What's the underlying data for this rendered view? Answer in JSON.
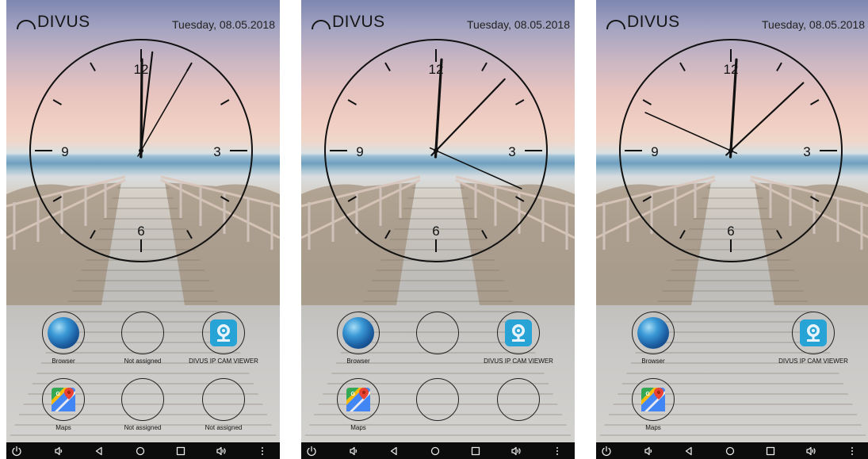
{
  "screens": [
    {
      "logo": "DIVUS",
      "date": "Tuesday, 08.05.2018",
      "clock": {
        "numerals": [
          "12",
          "3",
          "6",
          "9"
        ],
        "time": {
          "hour": 12,
          "minute": 1,
          "second": 5
        }
      },
      "slots": [
        {
          "label": "Browser",
          "icon": "globe-icon"
        },
        {
          "label": "Not assigned",
          "icon": "empty"
        },
        {
          "label": "DIVUS IP CAM VIEWER",
          "icon": "camera-icon"
        },
        {
          "label": "Maps",
          "icon": "maps-icon"
        },
        {
          "label": "Not assigned",
          "icon": "empty"
        },
        {
          "label": "Not assigned",
          "icon": "empty"
        }
      ]
    },
    {
      "logo": "DIVUS",
      "date": "Tuesday, 08.05.2018",
      "clock": {
        "numerals": [
          "12",
          "3",
          "6",
          "9"
        ],
        "time": {
          "hour": 12,
          "minute": 7,
          "second": 19
        }
      },
      "slots": [
        {
          "label": "Browser",
          "icon": "globe-icon"
        },
        {
          "label": "",
          "icon": "empty"
        },
        {
          "label": "DIVUS IP CAM VIEWER",
          "icon": "camera-icon"
        },
        {
          "label": "Maps",
          "icon": "maps-icon"
        },
        {
          "label": "",
          "icon": "empty"
        },
        {
          "label": "",
          "icon": "empty"
        }
      ]
    },
    {
      "logo": "DIVUS",
      "date": "Tuesday, 08.05.2018",
      "clock": {
        "numerals": [
          "12",
          "3",
          "6",
          "9"
        ],
        "time": {
          "hour": 12,
          "minute": 7,
          "second": 49
        }
      },
      "slots": [
        {
          "label": "Browser",
          "icon": "globe-icon"
        },
        {
          "label": "",
          "icon": "none"
        },
        {
          "label": "DIVUS IP CAM VIEWER",
          "icon": "camera-icon"
        },
        {
          "label": "Maps",
          "icon": "maps-icon"
        },
        {
          "label": "",
          "icon": "none"
        },
        {
          "label": "",
          "icon": "none"
        }
      ]
    }
  ],
  "navbar": [
    "power-icon",
    "volume-down-icon",
    "back-icon",
    "home-icon",
    "recents-icon",
    "volume-up-icon",
    "menu-icon"
  ],
  "colors": {
    "text": "#161616",
    "navbar": "#0c0c0c",
    "camera_tile": "#27a3d6"
  }
}
